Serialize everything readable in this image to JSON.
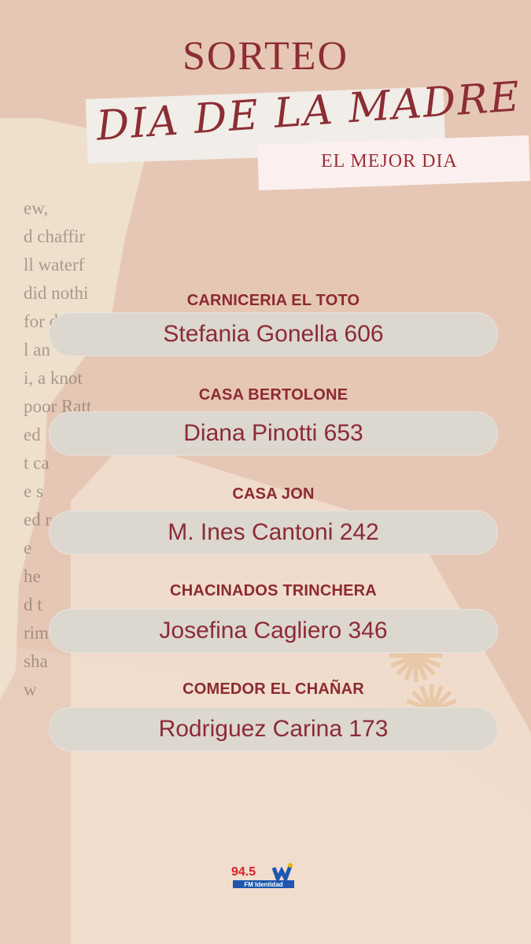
{
  "header": {
    "sorteo": "SORTEO",
    "dia_madre": "DIA DE LA MADRE",
    "mejor_dia": "EL MEJOR DIA"
  },
  "texture_text": [
    "ew,",
    "d chaffir",
    "ll waterf",
    "did nothi",
    "for d",
    "l an",
    "",
    "",
    "i, a knot",
    "poor Ratt",
    "ed",
    "t ca",
    "e s",
    "ed r",
    "e",
    "he",
    "d t",
    "rim",
    "sha",
    "w"
  ],
  "entries": [
    {
      "sponsor": "CARNICERIA EL TOTO",
      "winner": "Stefania Gonella 606"
    },
    {
      "sponsor": "CASA BERTOLONE",
      "winner": "Diana Pinotti 653"
    },
    {
      "sponsor": "CASA JON",
      "winner": "M. Ines Cantoni 242"
    },
    {
      "sponsor": "CHACINADOS TRINCHERA",
      "winner": "Josefina Cagliero 346"
    },
    {
      "sponsor": "COMEDOR EL CHAÑAR",
      "winner": "Rodriguez Carina 173"
    }
  ],
  "logo": {
    "frequency": "94.5",
    "name": "FM Identidad"
  }
}
